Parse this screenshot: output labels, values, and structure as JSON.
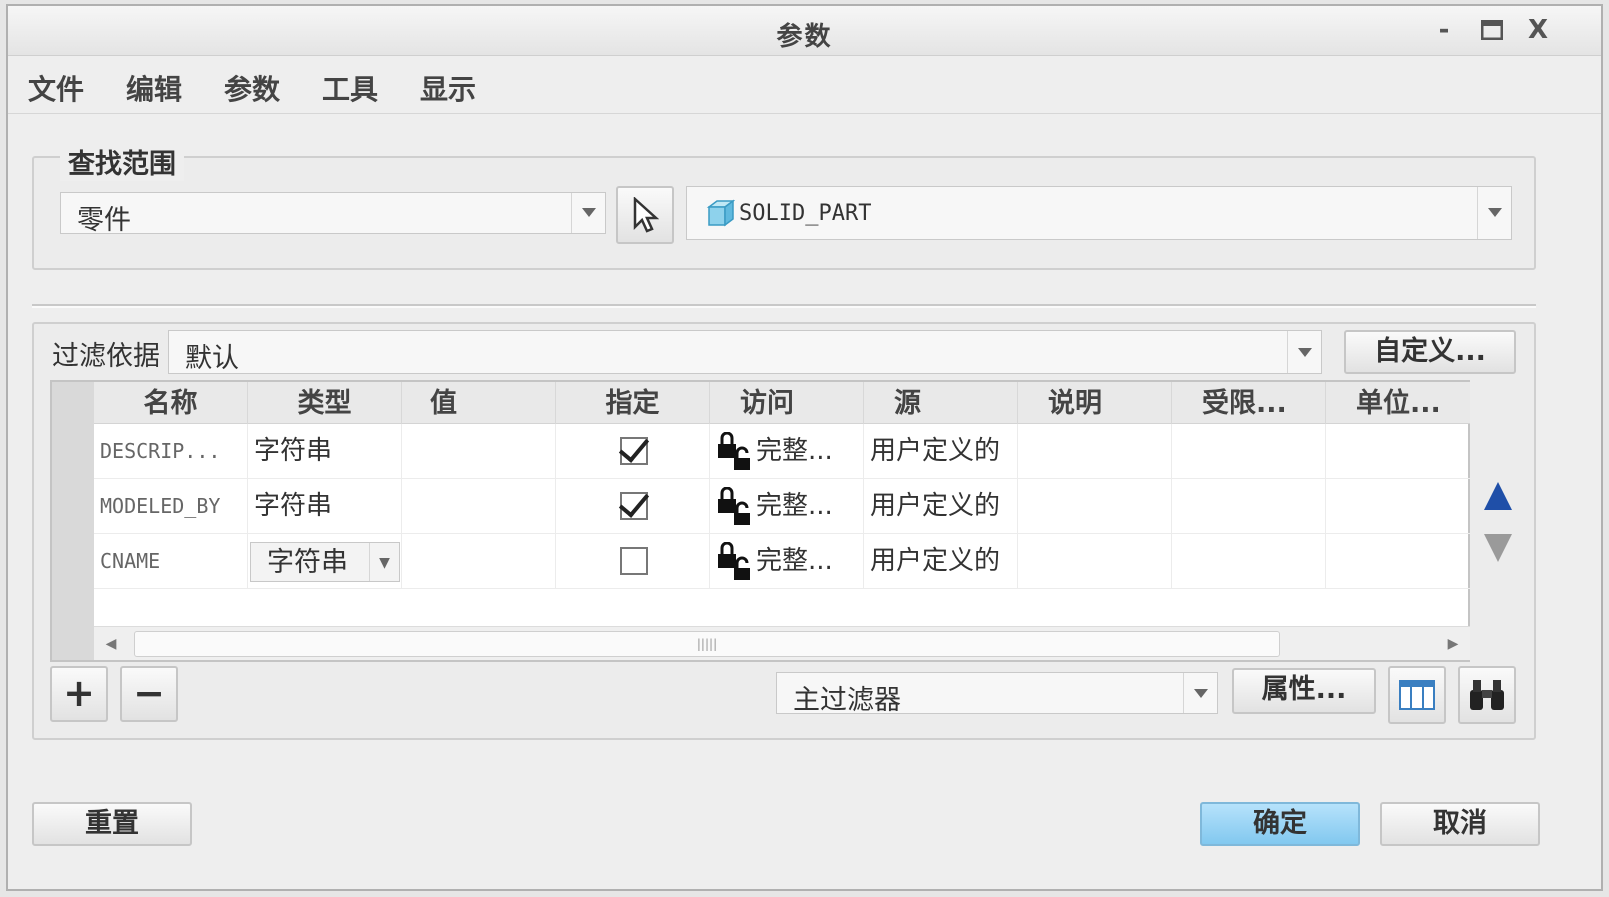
{
  "window": {
    "title": "参数",
    "controls": [
      "-",
      "□",
      "X"
    ]
  },
  "menu": [
    "文件",
    "编辑",
    "参数",
    "工具",
    "显示"
  ],
  "scope": {
    "legend": "查找范围",
    "type_value": "零件",
    "object_value": "SOLID_PART"
  },
  "filter": {
    "label": "过滤依据",
    "value": "默认",
    "customize_label": "自定义..."
  },
  "table": {
    "columns": [
      "名称",
      "类型",
      "值",
      "指定",
      "访问",
      "源",
      "说明",
      "受限...",
      "单位..."
    ],
    "rows": [
      {
        "name": "DESCRIP...",
        "type": "字符串",
        "value": "",
        "designated": true,
        "access": "完整...",
        "source": "用户定义的"
      },
      {
        "name": "MODELED_BY",
        "type": "字符串",
        "value": "",
        "designated": true,
        "access": "完整...",
        "source": "用户定义的"
      },
      {
        "name": "CNAME",
        "type": "字符串",
        "value": "",
        "designated": false,
        "access": "完整...",
        "source": "用户定义的"
      }
    ]
  },
  "bottom": {
    "add_label": "+",
    "remove_label": "−",
    "main_filter": "主过滤器",
    "properties_label": "属性..."
  },
  "footer": {
    "reset_label": "重置",
    "ok_label": "确定",
    "cancel_label": "取消"
  },
  "colors": {
    "accent_up": "#1f4fa8",
    "ok_button": "#8fcff3"
  }
}
